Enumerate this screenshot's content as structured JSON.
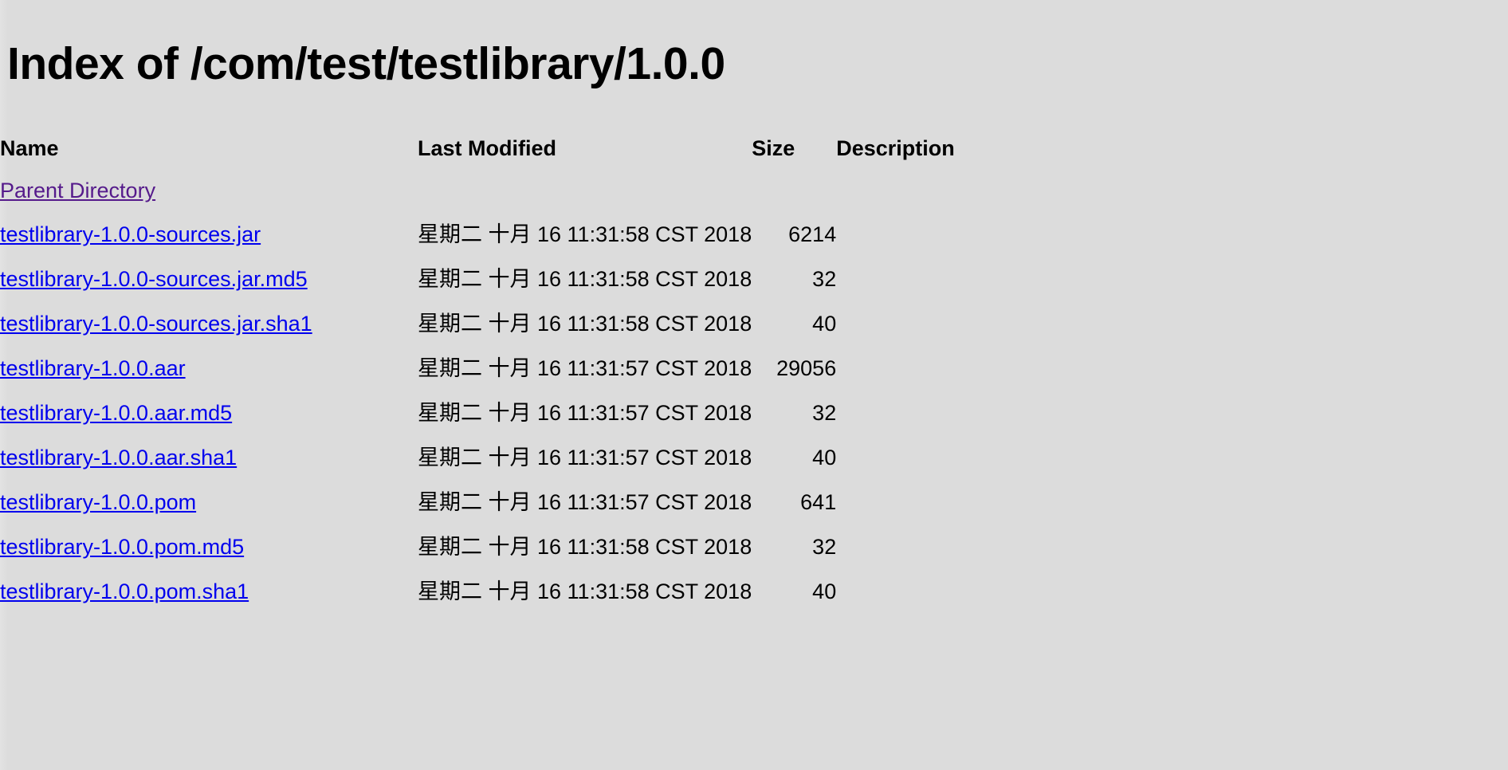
{
  "page": {
    "title": "Index of /com/test/testlibrary/1.0.0",
    "background_color": "#dcdcdc",
    "link_color": "#0000ee",
    "visited_link_color": "#551a8b",
    "text_color": "#000000"
  },
  "table": {
    "headers": {
      "name": "Name",
      "last_modified": "Last Modified",
      "size": "Size",
      "description": "Description"
    },
    "parent": {
      "label": "Parent Directory",
      "last_modified": "",
      "size": "",
      "description": ""
    },
    "rows": [
      {
        "name": "testlibrary-1.0.0-sources.jar",
        "last_modified": "星期二 十月 16 11:31:58 CST 2018",
        "size": "6214",
        "description": ""
      },
      {
        "name": "testlibrary-1.0.0-sources.jar.md5",
        "last_modified": "星期二 十月 16 11:31:58 CST 2018",
        "size": "32",
        "description": ""
      },
      {
        "name": "testlibrary-1.0.0-sources.jar.sha1",
        "last_modified": "星期二 十月 16 11:31:58 CST 2018",
        "size": "40",
        "description": ""
      },
      {
        "name": "testlibrary-1.0.0.aar",
        "last_modified": "星期二 十月 16 11:31:57 CST 2018",
        "size": "29056",
        "description": ""
      },
      {
        "name": "testlibrary-1.0.0.aar.md5",
        "last_modified": "星期二 十月 16 11:31:57 CST 2018",
        "size": "32",
        "description": ""
      },
      {
        "name": "testlibrary-1.0.0.aar.sha1",
        "last_modified": "星期二 十月 16 11:31:57 CST 2018",
        "size": "40",
        "description": ""
      },
      {
        "name": "testlibrary-1.0.0.pom",
        "last_modified": "星期二 十月 16 11:31:57 CST 2018",
        "size": "641",
        "description": ""
      },
      {
        "name": "testlibrary-1.0.0.pom.md5",
        "last_modified": "星期二 十月 16 11:31:58 CST 2018",
        "size": "32",
        "description": ""
      },
      {
        "name": "testlibrary-1.0.0.pom.sha1",
        "last_modified": "星期二 十月 16 11:31:58 CST 2018",
        "size": "40",
        "description": ""
      }
    ]
  }
}
